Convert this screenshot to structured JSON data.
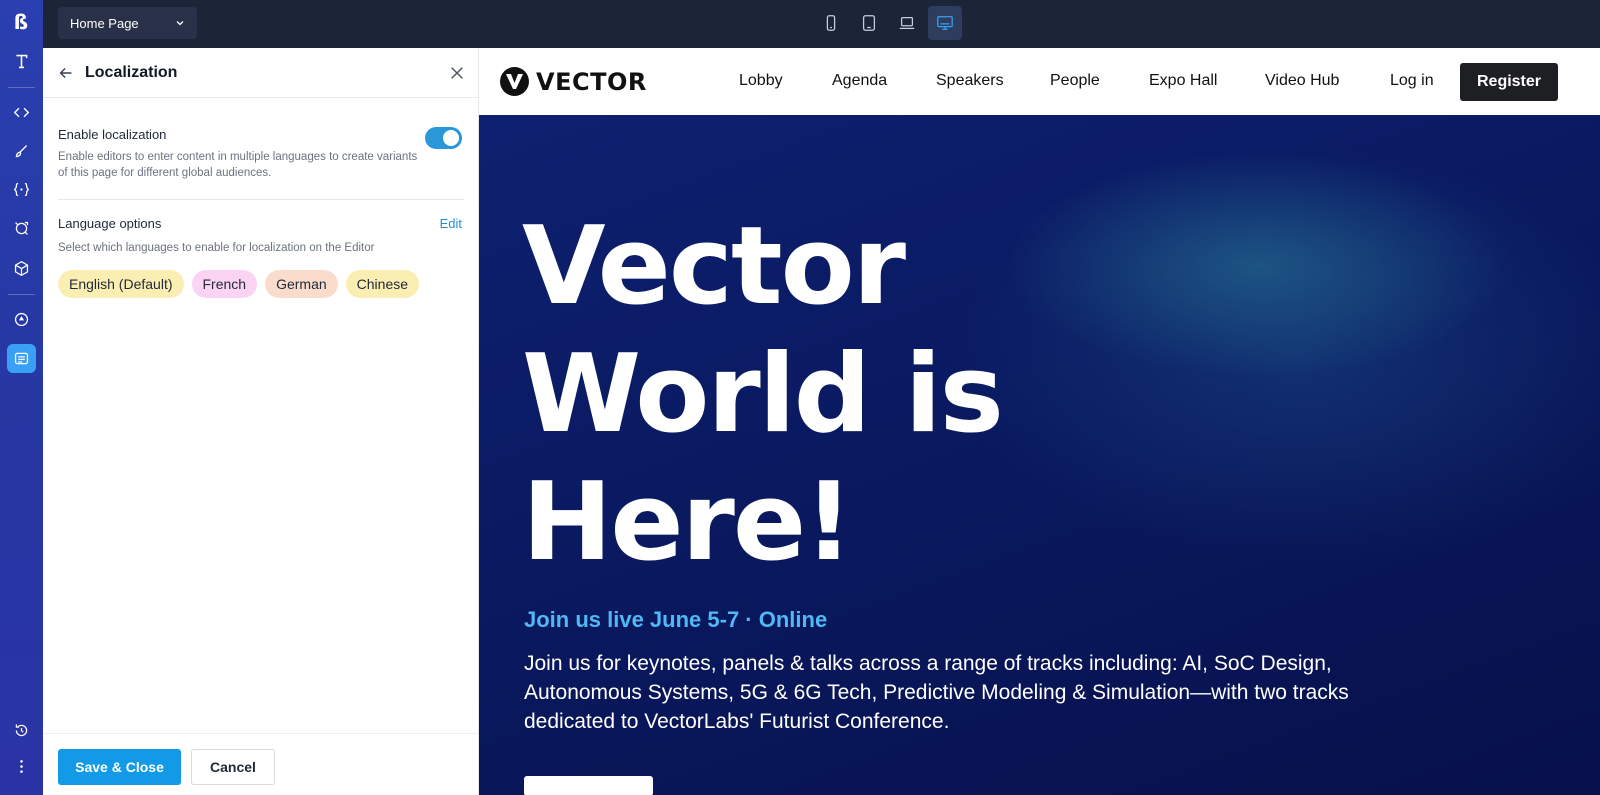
{
  "app": {
    "page_selector": "Home Page",
    "devices": [
      "mobile-icon",
      "tablet-icon",
      "laptop-icon",
      "desktop-icon"
    ],
    "accent": "#139ae6"
  },
  "panel": {
    "title": "Localization",
    "enable_label": "Enable localization",
    "enable_help": "Enable editors to enter content in multiple languages to create variants of this page for different global audiences.",
    "enabled": true,
    "languages_label": "Language options",
    "edit_label": "Edit",
    "languages_help": "Select which languages to enable for localization on the Editor",
    "languages": [
      {
        "label": "English (Default)",
        "color": "#fbeeb2"
      },
      {
        "label": "French",
        "color": "#fbd4f4"
      },
      {
        "label": "German",
        "color": "#fadccc"
      },
      {
        "label": "Chinese",
        "color": "#fbeeb2"
      }
    ],
    "save_label": "Save & Close",
    "cancel_label": "Cancel"
  },
  "site": {
    "brand": "VECTOR",
    "nav": [
      "Lobby",
      "Agenda",
      "Speakers",
      "People",
      "Expo Hall",
      "Video Hub",
      "Log in"
    ],
    "register_label": "Register",
    "hero_title": "Vector World is Here!",
    "hero_date": "Join us live June 5-7  ·  Online",
    "hero_body": "Join us for keynotes, panels & talks across a range of tracks including: AI, SoC Design, Autonomous Systems, 5G & 6G Tech, Predictive Modeling & Simulation—with two tracks dedicated to VectorLabs' Futurist Conference."
  }
}
